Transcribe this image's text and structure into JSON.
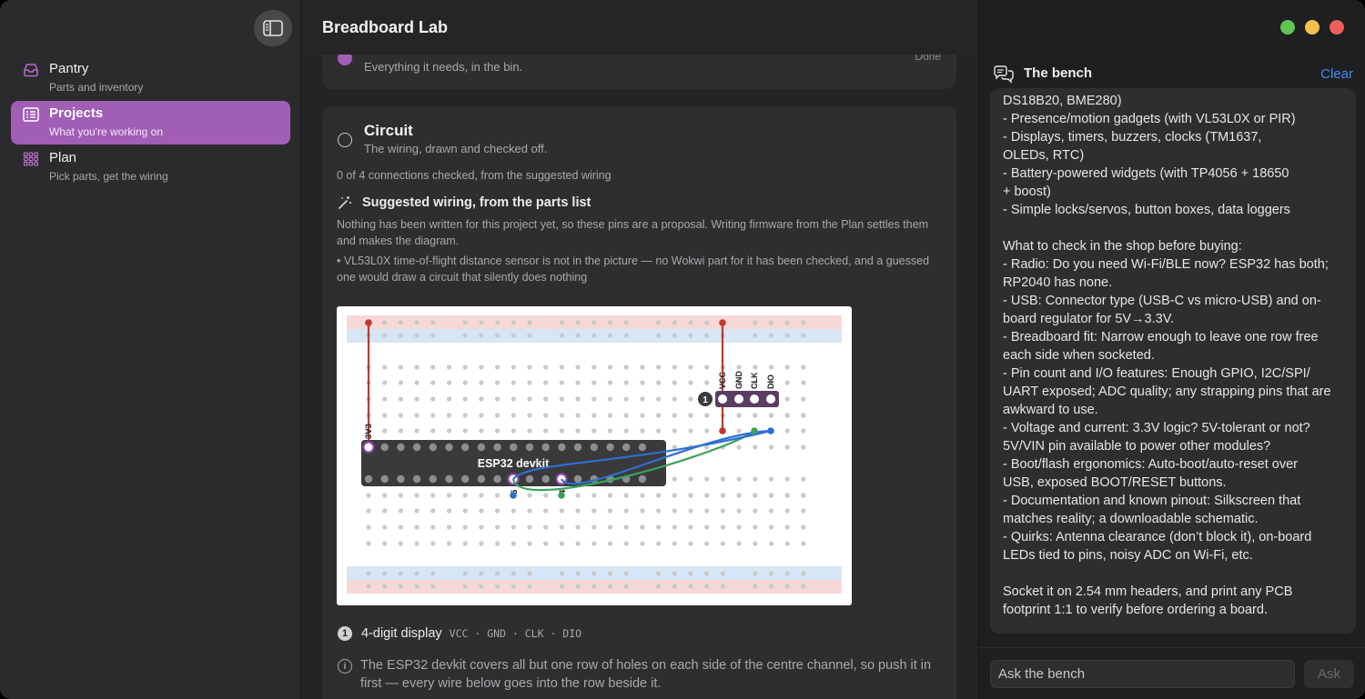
{
  "app": {
    "title": "Breadboard Lab"
  },
  "sidebar": {
    "items": [
      {
        "label": "Pantry",
        "sub": "Parts and inventory",
        "icon": "tray-icon"
      },
      {
        "label": "Projects",
        "sub": "What you're working on",
        "icon": "list-icon"
      },
      {
        "label": "Plan",
        "sub": "Pick parts, get the wiring",
        "icon": "grid-icon"
      }
    ],
    "active_index": 1
  },
  "main": {
    "top_card": {
      "sub": "Everything it needs, in the bin.",
      "status": "Done"
    },
    "circuit": {
      "title": "Circuit",
      "subtitle": "The wiring, drawn and checked off.",
      "count": "0 of 4 connections checked, from the suggested wiring",
      "suggested_title": "Suggested wiring, from the parts list",
      "note": "Nothing has been written for this project yet, so these pins are a proposal. Writing firmware from the Plan settles them and makes the diagram.",
      "bullet": "• VL53L0X time-of-flight distance sensor is not in the picture — no Wokwi part for it has been checked, and a guessed one would draw a circuit that silently does nothing",
      "diagram": {
        "devkit_label": "ESP32 devkit",
        "pin_3v3": "3V3",
        "pin_5": "5",
        "pin_4": "4",
        "module_badge": "1",
        "module_pins": [
          "VCC",
          "GND",
          "CLK",
          "DIO"
        ]
      },
      "legend": {
        "num": "1",
        "name": "4-digit display",
        "pins": "VCC · GND · CLK · DIO"
      },
      "info": "The ESP32 devkit covers all but one row of holes on each side of the centre channel, so push it in first — every wire below goes into the row beside it."
    }
  },
  "bench": {
    "title": "The bench",
    "clear_label": "Clear",
    "lines": [
      "DS18B20, BME280)",
      "- Presence/motion gadgets (with VL53L0X or PIR)",
      "- Displays, timers, buzzers, clocks (TM1637,",
      "OLEDs, RTC)",
      "- Battery-powered widgets (with TP4056 + 18650",
      "+ boost)",
      "- Simple locks/servos, button boxes, data loggers",
      "",
      "What to check in the shop before buying:",
      "- Radio: Do you need Wi-Fi/BLE now? ESP32 has both;",
      "RP2040 has none.",
      "- USB: Connector type (USB-C vs micro-USB) and on-",
      "board regulator for 5V→3.3V.",
      "- Breadboard fit: Narrow enough to leave one row free",
      "each side when socketed.",
      "- Pin count and I/O features: Enough GPIO, I2C/SPI/",
      "UART exposed; ADC quality; any strapping pins that are",
      "awkward to use.",
      "- Voltage and current: 3.3V logic? 5V-tolerant or not?",
      "5V/VIN pin available to power other modules?",
      "- Boot/flash ergonomics: Auto-boot/auto-reset over",
      "USB, exposed BOOT/RESET buttons.",
      "- Documentation and known pinout: Silkscreen that",
      "matches reality; a downloadable schematic.",
      "- Quirks: Antenna clearance (don’t block it), on-board",
      "LEDs tied to pins, noisy ADC on Wi-Fi, etc.",
      "",
      "Socket it on 2.54 mm headers, and print any PCB",
      "footprint 1:1 to verify before ordering a board."
    ],
    "input_placeholder": "Ask the bench",
    "ask_label": "Ask"
  },
  "colors": {
    "accent": "#a05eb5",
    "link": "#3d8ff5",
    "wire_power": "#c0392b",
    "wire_clk": "#3aa35a",
    "wire_dio": "#2f6fd0",
    "close": "#ec5f5a",
    "minimize": "#f4bf4f",
    "zoom": "#61c554"
  }
}
